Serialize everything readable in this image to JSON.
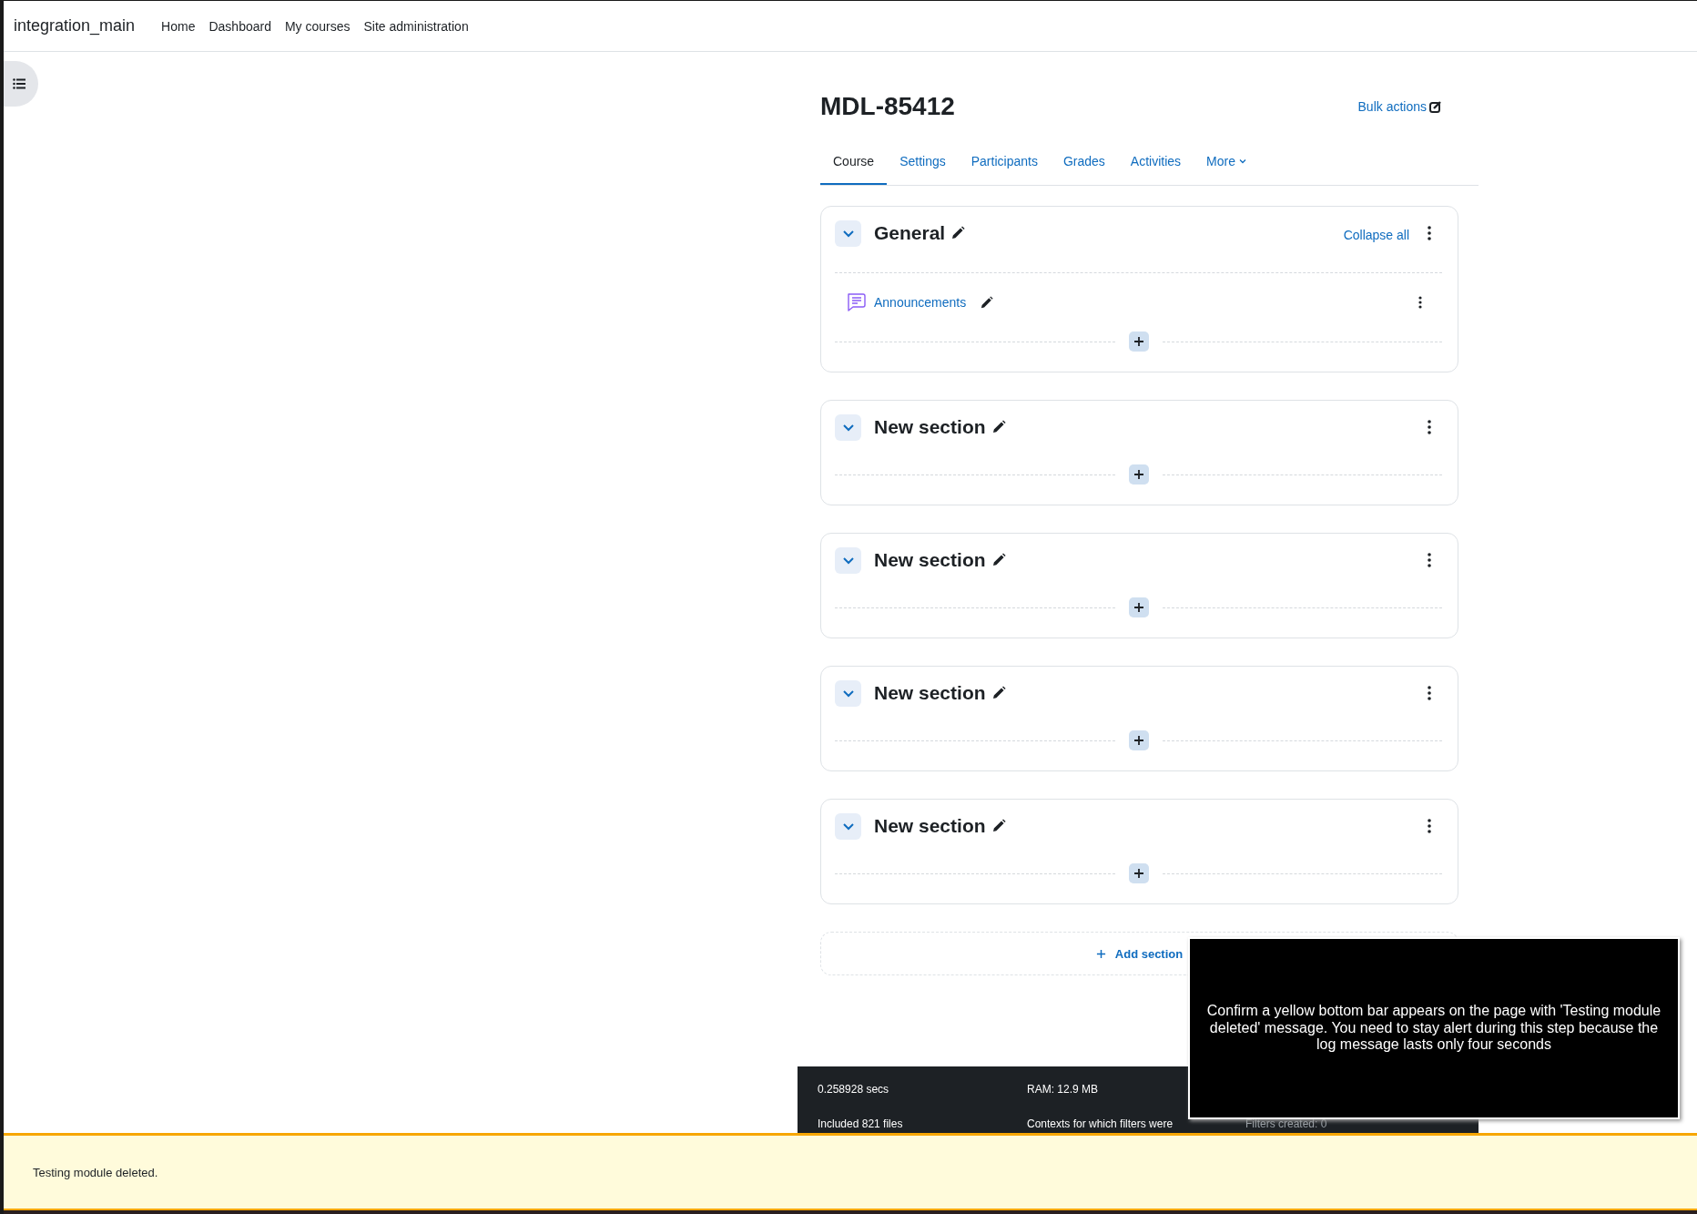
{
  "site_name": "integration_main",
  "nav": [
    {
      "label": "Home"
    },
    {
      "label": "Dashboard"
    },
    {
      "label": "My courses"
    },
    {
      "label": "Site administration"
    }
  ],
  "course": {
    "title": "MDL-85412",
    "bulk_actions": "Bulk actions"
  },
  "tabs": [
    {
      "label": "Course",
      "selected": true,
      "kind": "link"
    },
    {
      "label": "Settings",
      "selected": false,
      "kind": "link"
    },
    {
      "label": "Participants",
      "selected": false,
      "kind": "link"
    },
    {
      "label": "Grades",
      "selected": false,
      "kind": "link"
    },
    {
      "label": "Activities",
      "selected": false,
      "kind": "link"
    },
    {
      "label": "More",
      "selected": false,
      "kind": "dropdown"
    }
  ],
  "sections": [
    {
      "title": "General",
      "expanded": true,
      "collapse_all": "Collapse all",
      "activities": [
        {
          "name": "Announcements"
        }
      ]
    },
    {
      "title": "New section",
      "expanded": true
    },
    {
      "title": "New section",
      "expanded": true
    },
    {
      "title": "New section",
      "expanded": true
    },
    {
      "title": "New section",
      "expanded": true
    }
  ],
  "add_section": "Add section",
  "footer": {
    "cells": [
      "0.258928 secs",
      "RAM: 12.9 MB",
      "Included 821 files",
      "Contexts for which filters were",
      "Filters created: 0"
    ]
  },
  "alert": {
    "message": "Testing module deleted."
  },
  "overlay": {
    "text": "Confirm a yellow bottom bar appears on the page with 'Testing module deleted' message. You need to stay alert during this step because the log message lasts only four seconds"
  }
}
